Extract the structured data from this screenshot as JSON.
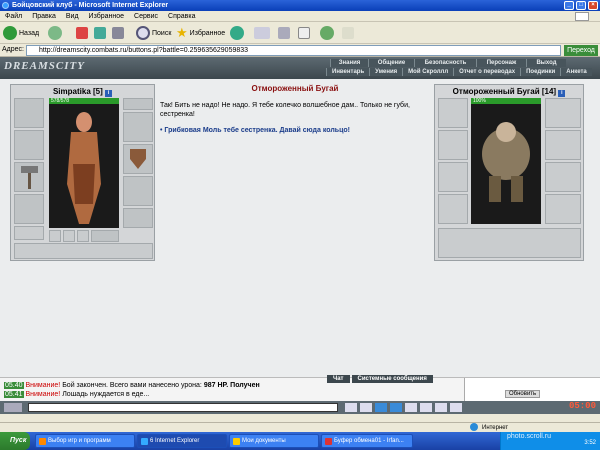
{
  "window": {
    "title": "Бойцовский клуб - Microsoft Internet Explorer",
    "colors": {
      "titlebar": "#0a3fb8",
      "start": "#2c7a2c",
      "accent_red": "#cc0000"
    }
  },
  "menu": [
    "Файл",
    "Правка",
    "Вид",
    "Избранное",
    "Сервис",
    "Справка"
  ],
  "toolbar": {
    "back": "Назад",
    "search": "Поиск",
    "favorites": "Избранное"
  },
  "address": {
    "label": "Адрес:",
    "url": "http://dreamscity.combats.ru/buttons.pl?battle=0.259635629059833",
    "go": "Переход"
  },
  "site": {
    "logo": "DREAMSCITY",
    "nav_top": [
      "Знания",
      "Общение",
      "Безопасность",
      "Персонаж",
      "Выход"
    ],
    "nav_bottom": [
      "Инвентарь",
      "Умения",
      "Мой Скроллл",
      "Отчет о переводах",
      "Поединки",
      "Анкета"
    ]
  },
  "player": {
    "name": "Simpatika",
    "level": "[5]",
    "hp": "578/578",
    "hp_fraction": 1.0
  },
  "opponent": {
    "name": "Отмороженный Бугай",
    "level": "[14]",
    "hp": "100%",
    "hp_fraction": 1.0
  },
  "dialog": {
    "title": "Отмороженный Бугай",
    "text": "Так! Бить не надо! Не надо. Я тебе колечко волшебное дам.. Только не губи, сестренка!",
    "option": "Грибковая Моль тебе сестренка. Давай сюда кольцо!"
  },
  "chat": {
    "tabs": [
      "Чат",
      "Системные сообщения"
    ],
    "lines": [
      {
        "time": "05.40",
        "label": "Внимание!",
        "text": "Бой закончен. Всего вами нанесено урона:",
        "extra": "987 HP. Получен"
      },
      {
        "time": "05.41",
        "label": "Внимание!",
        "text": "Лошадь нуждается в еде..."
      }
    ],
    "refresh": "Обновить",
    "clock": "05:00"
  },
  "status": {
    "zone": "Интернет"
  },
  "taskbar": {
    "start": "Пуск",
    "tasks": [
      "Выбор игр и программ",
      "6 Internet Explorer",
      "Мои документы",
      "Буфер обмена01 - Irfan..."
    ],
    "clock": "3:52"
  },
  "watermark": "photo.scroll.ru"
}
